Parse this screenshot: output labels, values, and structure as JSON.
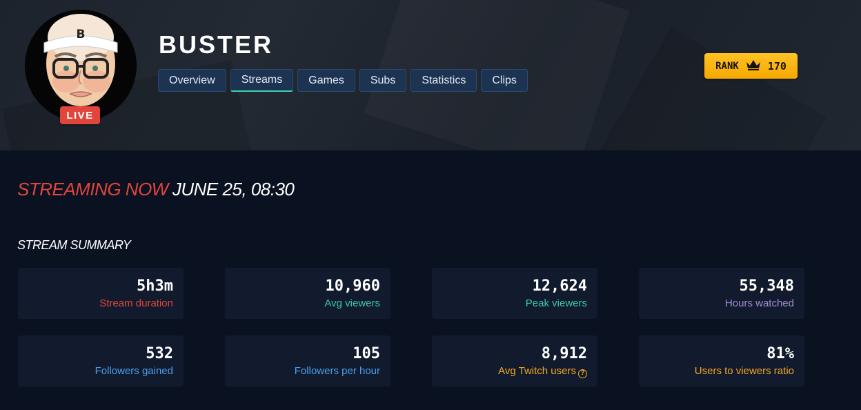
{
  "channel": {
    "name": "BUSTER",
    "live_label": "LIVE",
    "avatar_letter": "B"
  },
  "tabs": [
    {
      "label": "Overview",
      "active": false
    },
    {
      "label": "Streams",
      "active": true
    },
    {
      "label": "Games",
      "active": false
    },
    {
      "label": "Subs",
      "active": false
    },
    {
      "label": "Statistics",
      "active": false
    },
    {
      "label": "Clips",
      "active": false
    }
  ],
  "rank": {
    "label": "RANK",
    "value": "170",
    "icon": "crown-icon",
    "color": "#f5a800"
  },
  "stream": {
    "status": "STREAMING NOW",
    "date": "JUNE 25, 08:30"
  },
  "summary": {
    "heading": "STREAM SUMMARY",
    "cards": [
      {
        "value": "5h3m",
        "label": "Stream duration",
        "color": "#e2453c"
      },
      {
        "value": "10,960",
        "label": "Avg viewers",
        "color": "#3ec9a7"
      },
      {
        "value": "12,624",
        "label": "Peak viewers",
        "color": "#3ec9a7"
      },
      {
        "value": "55,348",
        "label": "Hours watched",
        "color": "#a38bd6"
      },
      {
        "value": "532",
        "label": "Followers gained",
        "color": "#4aa0f0"
      },
      {
        "value": "105",
        "label": "Followers per hour",
        "color": "#4aa0f0"
      },
      {
        "value": "8,912",
        "label": "Avg Twitch users",
        "color": "#f5a623",
        "help_icon": "question-circle-icon"
      },
      {
        "value": "81%",
        "label": "Users to viewers ratio",
        "color": "#f5a623"
      }
    ]
  }
}
